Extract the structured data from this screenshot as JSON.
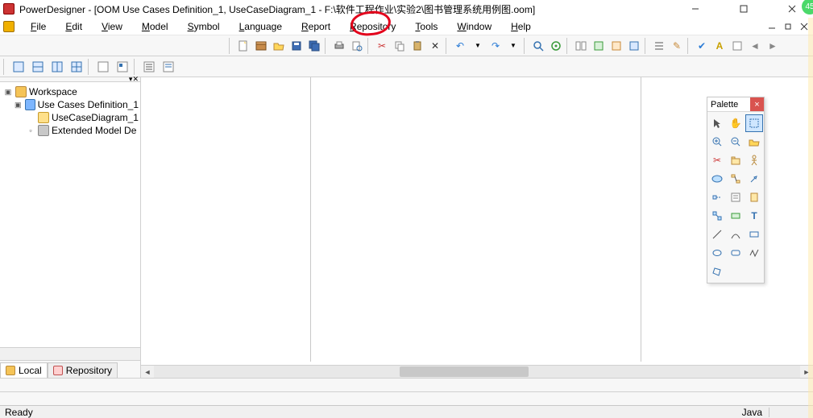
{
  "title": "PowerDesigner - [OOM Use Cases Definition_1, UseCaseDiagram_1 - F:\\软件工程作业\\实验2\\图书管理系统用例图.oom]",
  "menu": {
    "file": {
      "label": "File",
      "mnemonic_index": 0
    },
    "edit": {
      "label": "Edit",
      "mnemonic_index": 0
    },
    "view": {
      "label": "View",
      "mnemonic_index": 0
    },
    "model": {
      "label": "Model",
      "mnemonic_index": 0
    },
    "symbol": {
      "label": "Symbol",
      "mnemonic_index": 0
    },
    "language": {
      "label": "Language",
      "mnemonic_index": 0
    },
    "report": {
      "label": "Report",
      "mnemonic_index": 0
    },
    "repository": {
      "label": "Repository",
      "mnemonic_index": 0
    },
    "tools": {
      "label": "Tools",
      "mnemonic_index": 0
    },
    "window": {
      "label": "Window",
      "mnemonic_index": 0
    },
    "help": {
      "label": "Help",
      "mnemonic_index": 0
    }
  },
  "tree": {
    "root": "Workspace",
    "model": "Use Cases Definition_1",
    "diagram": "UseCaseDiagram_1",
    "ext": "Extended Model De"
  },
  "sidebar_tabs": {
    "local": "Local",
    "repository": "Repository"
  },
  "palette": {
    "title": "Palette"
  },
  "status": {
    "left": "Ready",
    "right": "Java"
  },
  "badge": "45"
}
